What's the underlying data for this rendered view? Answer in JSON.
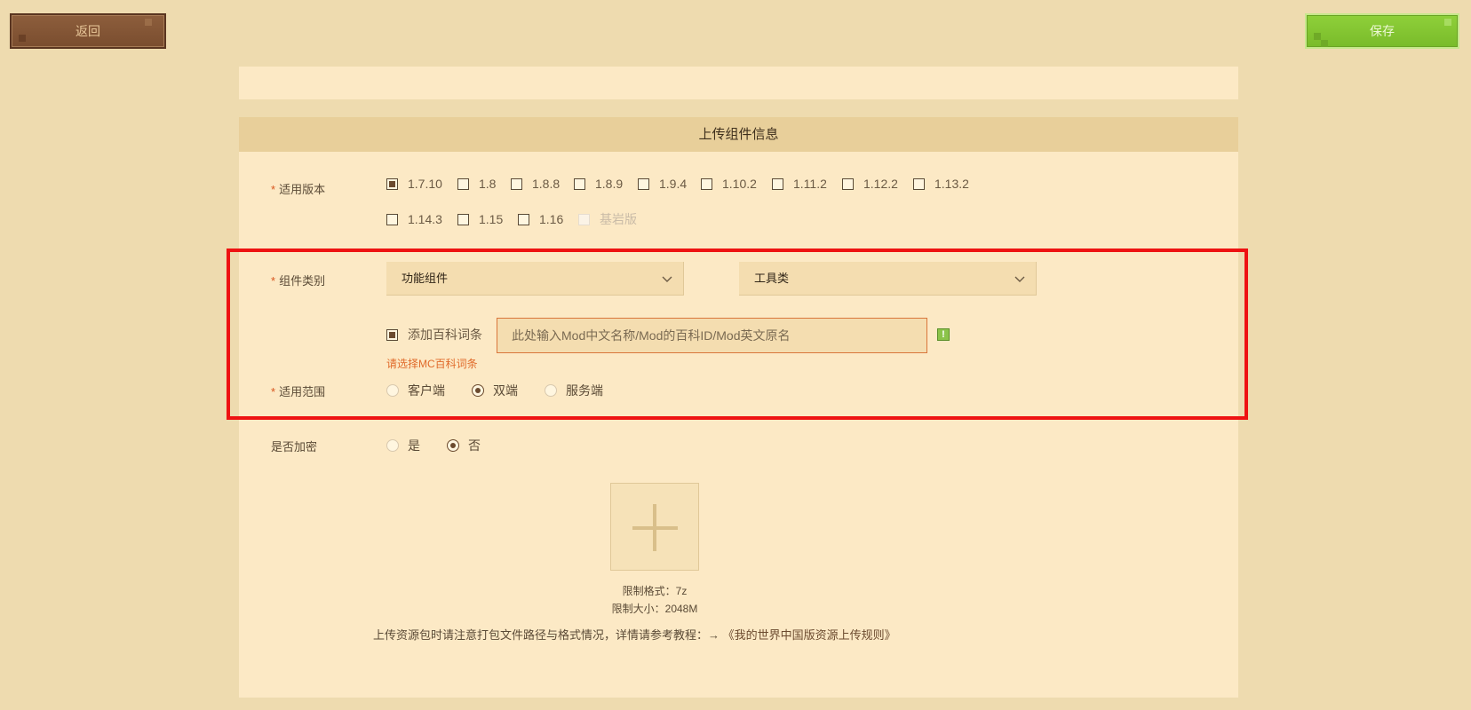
{
  "toolbar": {
    "back_label": "返回",
    "save_label": "保存"
  },
  "panel": {
    "title": "上传组件信息"
  },
  "version": {
    "label": "适用版本",
    "options": [
      {
        "label": "1.7.10",
        "checked": true
      },
      {
        "label": "1.8",
        "checked": false
      },
      {
        "label": "1.8.8",
        "checked": false
      },
      {
        "label": "1.8.9",
        "checked": false
      },
      {
        "label": "1.9.4",
        "checked": false
      },
      {
        "label": "1.10.2",
        "checked": false
      },
      {
        "label": "1.11.2",
        "checked": false
      },
      {
        "label": "1.12.2",
        "checked": false
      },
      {
        "label": "1.13.2",
        "checked": false
      },
      {
        "label": "1.14.3",
        "checked": false
      },
      {
        "label": "1.15",
        "checked": false
      },
      {
        "label": "1.16",
        "checked": false
      },
      {
        "label": "基岩版",
        "checked": false,
        "disabled": true
      }
    ]
  },
  "category": {
    "label": "组件类别",
    "primary_value": "功能组件",
    "secondary_value": "工具类"
  },
  "wiki": {
    "checkbox_label": "添加百科词条",
    "checked": true,
    "placeholder": "此处输入Mod中文名称/Mod的百科ID/Mod英文原名",
    "warn_symbol": "!",
    "error": "请选择MC百科词条"
  },
  "scope": {
    "label": "适用范围",
    "options": [
      "客户端",
      "双端",
      "服务端"
    ],
    "selected": "双端"
  },
  "encrypt": {
    "label": "是否加密",
    "options": [
      "是",
      "否"
    ],
    "selected": "否"
  },
  "upload": {
    "limit_format": "限制格式：7z",
    "limit_size": "限制大小：2048M"
  },
  "note": {
    "text": "上传资源包时请注意打包文件路径与格式情况，详情请参考教程：→ ",
    "link": "《我的世界中国版资源上传规则》"
  },
  "colors": {
    "background": "#eedbaf",
    "panel": "#fce9c5",
    "header": "#e8cf9a",
    "back_button": "#7a4d2f",
    "save_button": "#8fd03a",
    "required_star": "#d8561f",
    "highlight_border": "#ee1212"
  }
}
